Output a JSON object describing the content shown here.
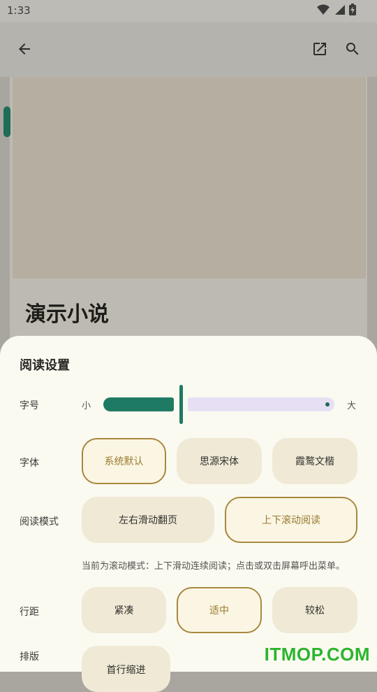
{
  "status_bar": {
    "time": "1:33",
    "icons": [
      "wifi-icon",
      "signal-icon",
      "battery-charging-icon"
    ]
  },
  "app_bar": {
    "icons": [
      "back-arrow-icon",
      "open-external-icon",
      "search-icon"
    ]
  },
  "book": {
    "title": "演示小说"
  },
  "settings": {
    "title": "阅读设置",
    "font_size": {
      "label": "字号",
      "small": "小",
      "large": "大",
      "level": 0.42
    },
    "font_family": {
      "label": "字体",
      "options": [
        "系统默认",
        "思源宋体",
        "霞鹜文楷"
      ],
      "selected": "系统默认"
    },
    "reading_mode": {
      "label": "阅读模式",
      "options": [
        "左右滑动翻页",
        "上下滚动阅读"
      ],
      "selected": "上下滚动阅读",
      "hint": "当前为滚动模式：上下滑动连续阅读；点击或双击屏幕呼出菜单。"
    },
    "line_spacing": {
      "label": "行距",
      "options": [
        "紧凑",
        "适中",
        "较松"
      ],
      "selected": "适中"
    },
    "layout": {
      "label": "排版",
      "options": [
        "首行缩进"
      ]
    }
  },
  "colors": {
    "accent": "#1f7a63",
    "selected_border": "#a8883f",
    "sheet_bg": "#fbfaf1",
    "chip_bg": "#efe9d6"
  },
  "watermark": "ITMOP.COM"
}
